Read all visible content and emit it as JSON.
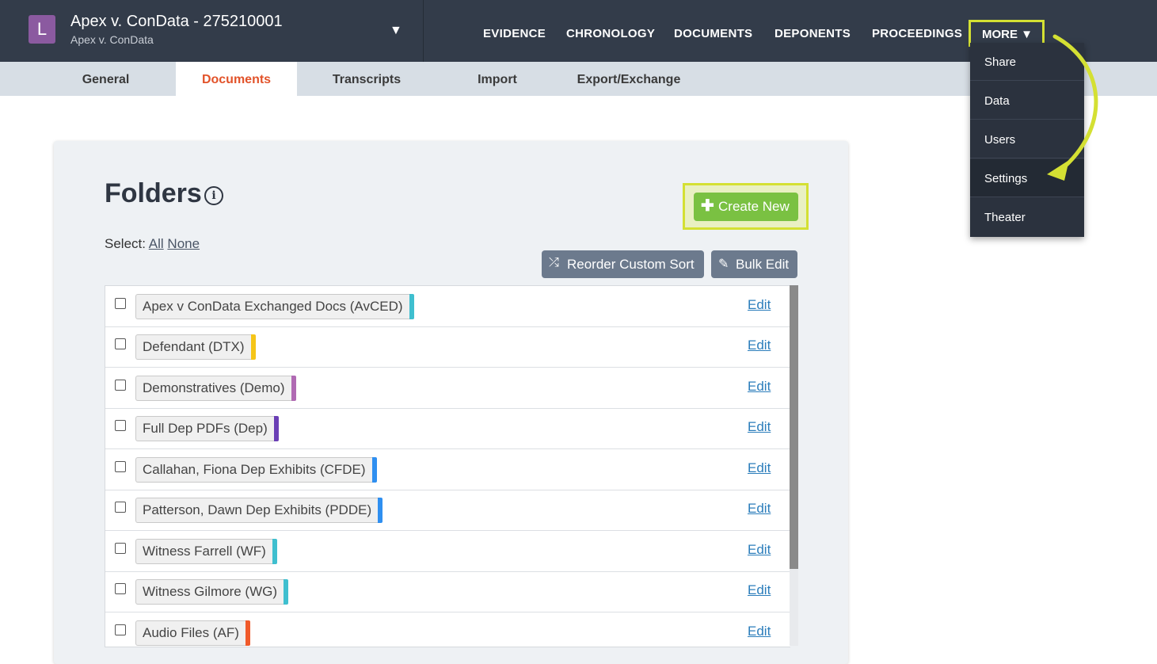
{
  "header": {
    "avatar_letter": "L",
    "case_title": "Apex v. ConData - 275210001",
    "case_subtitle": "Apex v. ConData",
    "nav": [
      "EVIDENCE",
      "CHRONOLOGY",
      "DOCUMENTS",
      "DEPONENTS",
      "PROCEEDINGS"
    ],
    "more_label": "MORE ▼"
  },
  "subtabs": [
    "General",
    "Documents",
    "Transcripts",
    "Import",
    "Export/Exchange"
  ],
  "active_subtab": "Documents",
  "more_menu": [
    "Share",
    "Data",
    "Users",
    "Settings",
    "Theater"
  ],
  "main": {
    "title": "Folders",
    "create_new_label": "Create New",
    "select_label": "Select:",
    "select_all": "All",
    "select_none": "None",
    "reorder_label": "Reorder Custom Sort",
    "bulk_edit_label": "Bulk Edit",
    "edit_label": "Edit"
  },
  "folders": [
    {
      "name": "Apex v ConData Exchanged Docs (AvCED)",
      "color": "#3fbfcf"
    },
    {
      "name": "Defendant (DTX)",
      "color": "#f5c518"
    },
    {
      "name": "Demonstratives (Demo)",
      "color": "#b06ab3"
    },
    {
      "name": "Full Dep PDFs (Dep)",
      "color": "#6a3fb5"
    },
    {
      "name": "Callahan, Fiona Dep Exhibits (CFDE)",
      "color": "#2f8ff0"
    },
    {
      "name": "Patterson, Dawn Dep Exhibits (PDDE)",
      "color": "#2f8ff0"
    },
    {
      "name": "Witness Farrell (WF)",
      "color": "#3fbfcf"
    },
    {
      "name": "Witness Gilmore (WG)",
      "color": "#3fbfcf"
    },
    {
      "name": "Audio Files (AF)",
      "color": "#f05a2a"
    }
  ],
  "colors": {
    "header_bg": "#333c4a",
    "highlight": "#d4e033",
    "active_tab_text": "#e2532a",
    "create_button": "#7ac142",
    "gray_button": "#6c7a8d"
  }
}
